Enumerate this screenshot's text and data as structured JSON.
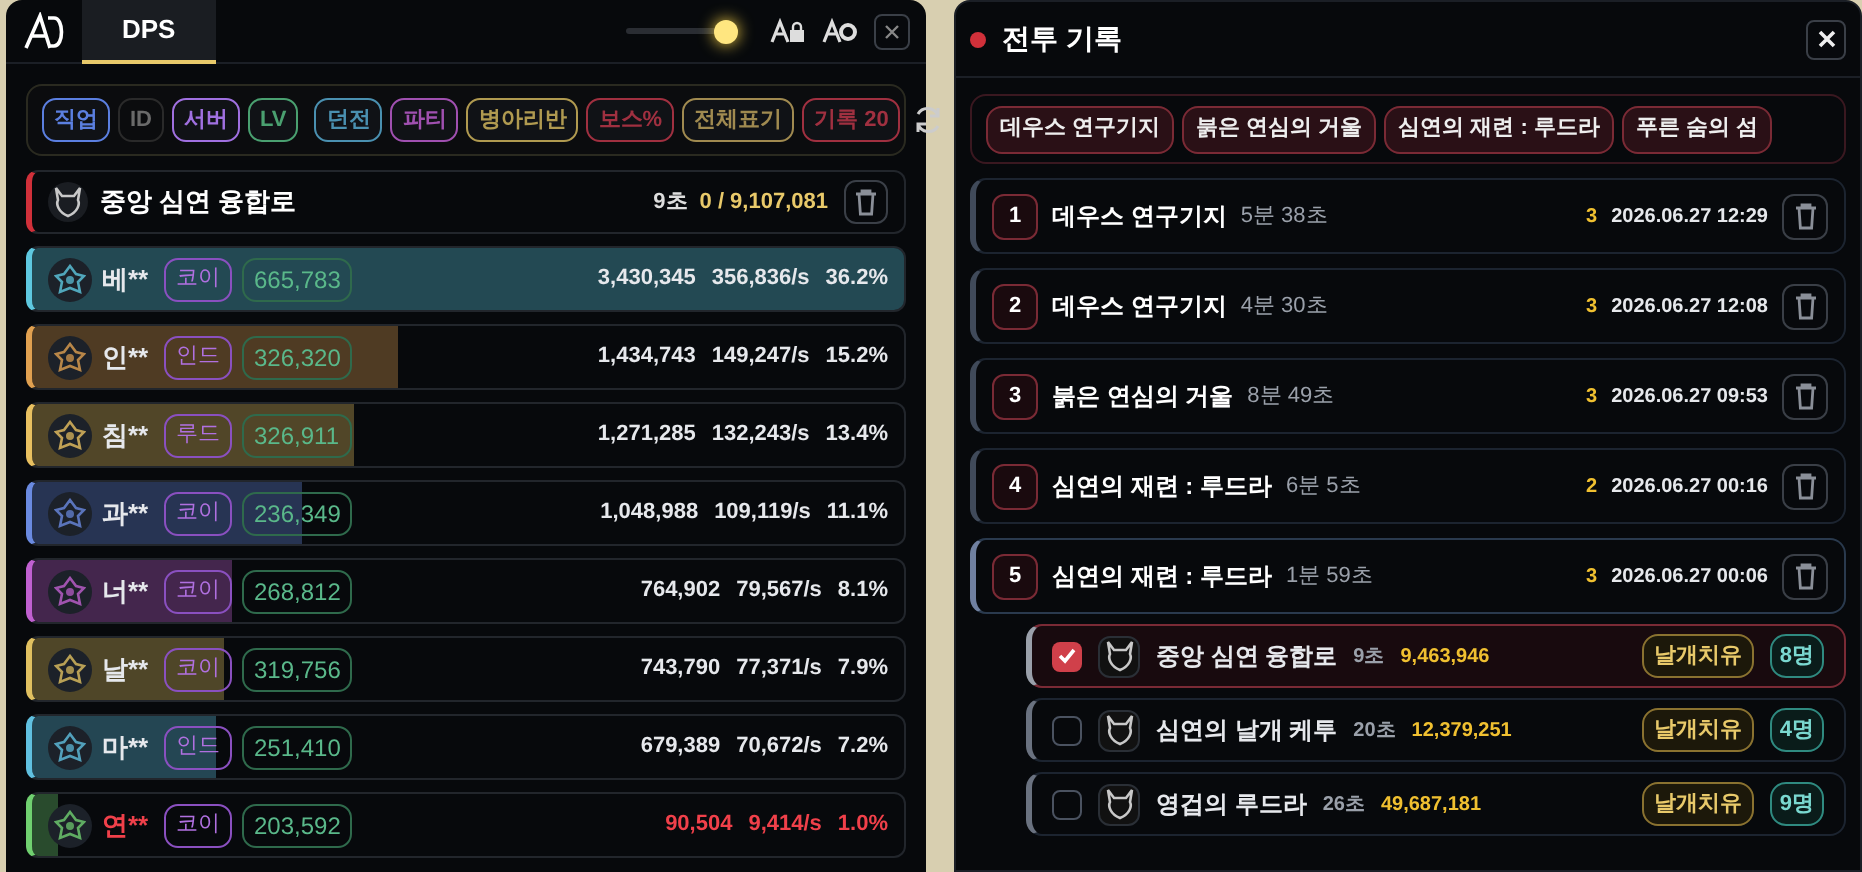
{
  "dps_panel": {
    "tab": {
      "label": "DPS",
      "selected": true
    },
    "slider": {
      "level": 1.0
    },
    "filters": [
      {
        "label": "직업",
        "color": "#5b7fe0",
        "on": true
      },
      {
        "label": "ID",
        "on": false
      },
      {
        "label": "서버",
        "color": "#a070e0",
        "on": true
      },
      {
        "label": "LV",
        "color": "#4aa070",
        "on": true
      },
      {
        "label": "던전",
        "color": "#4a90b0",
        "on": true
      },
      {
        "label": "파티",
        "color": "#a050b0",
        "on": true
      },
      {
        "label": "병아리반",
        "color": "#b09a50",
        "on": true
      },
      {
        "label": "보스%",
        "color": "#a03040",
        "on": true
      },
      {
        "label": "전체표기",
        "color": "#a08a50",
        "on": true
      },
      {
        "label": "기록 20",
        "color": "#a03040",
        "on": true
      }
    ],
    "boss": {
      "name": "중앙 심연 융합로",
      "time": "9초",
      "hp": "0 / 9,107,081"
    },
    "players": [
      {
        "name": "베**",
        "class": "코이",
        "power": "665,783",
        "damage": "3,430,345",
        "dps": "356,836/s",
        "share": "36.2%",
        "level": 1.0,
        "color": "#5ec8e0",
        "warning": false
      },
      {
        "name": "인**",
        "class": "인드",
        "power": "326,320",
        "damage": "1,434,743",
        "dps": "149,247/s",
        "share": "15.2%",
        "level": 0.42,
        "color": "#e0a050",
        "warning": false
      },
      {
        "name": "침**",
        "class": "루드",
        "power": "326,911",
        "damage": "1,271,285",
        "dps": "132,243/s",
        "share": "13.4%",
        "level": 0.37,
        "color": "#e8c060",
        "warning": false
      },
      {
        "name": "과**",
        "class": "코이",
        "power": "236,349",
        "damage": "1,048,988",
        "dps": "109,119/s",
        "share": "11.1%",
        "level": 0.31,
        "color": "#6a8ae0",
        "warning": false
      },
      {
        "name": "너**",
        "class": "코이",
        "power": "268,812",
        "damage": "764,902",
        "dps": "79,567/s",
        "share": "8.1%",
        "level": 0.23,
        "color": "#c060d0",
        "warning": false
      },
      {
        "name": "날**",
        "class": "코이",
        "power": "319,756",
        "damage": "743,790",
        "dps": "77,371/s",
        "share": "7.9%",
        "level": 0.22,
        "color": "#e0c060",
        "warning": false
      },
      {
        "name": "마**",
        "class": "인드",
        "power": "251,410",
        "damage": "679,389",
        "dps": "70,672/s",
        "share": "7.2%",
        "level": 0.21,
        "color": "#60c0e0",
        "warning": false
      },
      {
        "name": "연**",
        "class": "코이",
        "power": "203,592",
        "damage": "90,504",
        "dps": "9,414/s",
        "share": "1.0%",
        "level": 0.03,
        "color": "#70d070",
        "warning": true
      }
    ]
  },
  "history_panel": {
    "title": "전투 기록",
    "tags": [
      "데우스 연구기지",
      "붉은 연심의 거울",
      "심연의 재련 : 루드라",
      "푸른 숨의 섬"
    ],
    "records": [
      {
        "number": "1",
        "name": "데우스 연구기지",
        "duration": "5분 38초",
        "count": "3",
        "datetime": "2026.06.27 12:29",
        "expanded": false
      },
      {
        "number": "2",
        "name": "데우스 연구기지",
        "duration": "4분 30초",
        "count": "3",
        "datetime": "2026.06.27 12:08",
        "expanded": false
      },
      {
        "number": "3",
        "name": "붉은 연심의 거울",
        "duration": "8분 49초",
        "count": "3",
        "datetime": "2026.06.27 09:53",
        "expanded": false
      },
      {
        "number": "4",
        "name": "심연의 재련 : 루드라",
        "duration": "6분 5초",
        "count": "2",
        "datetime": "2026.06.27 00:16",
        "expanded": false
      },
      {
        "number": "5",
        "name": "심연의 재련 : 루드라",
        "duration": "1분 59초",
        "count": "3",
        "datetime": "2026.06.27 00:06",
        "expanded": true,
        "children": [
          {
            "name": "중앙 심연 융합로",
            "time": "9초",
            "damage": "9,463,946",
            "tag": "날개치유",
            "party": "8명",
            "checked": true
          },
          {
            "name": "심연의 날개 케투",
            "time": "20초",
            "damage": "12,379,251",
            "tag": "날개치유",
            "party": "4명",
            "checked": false
          },
          {
            "name": "영겁의 루드라",
            "time": "26초",
            "damage": "49,687,181",
            "tag": "날개치유",
            "party": "9명",
            "checked": false
          }
        ]
      }
    ]
  }
}
